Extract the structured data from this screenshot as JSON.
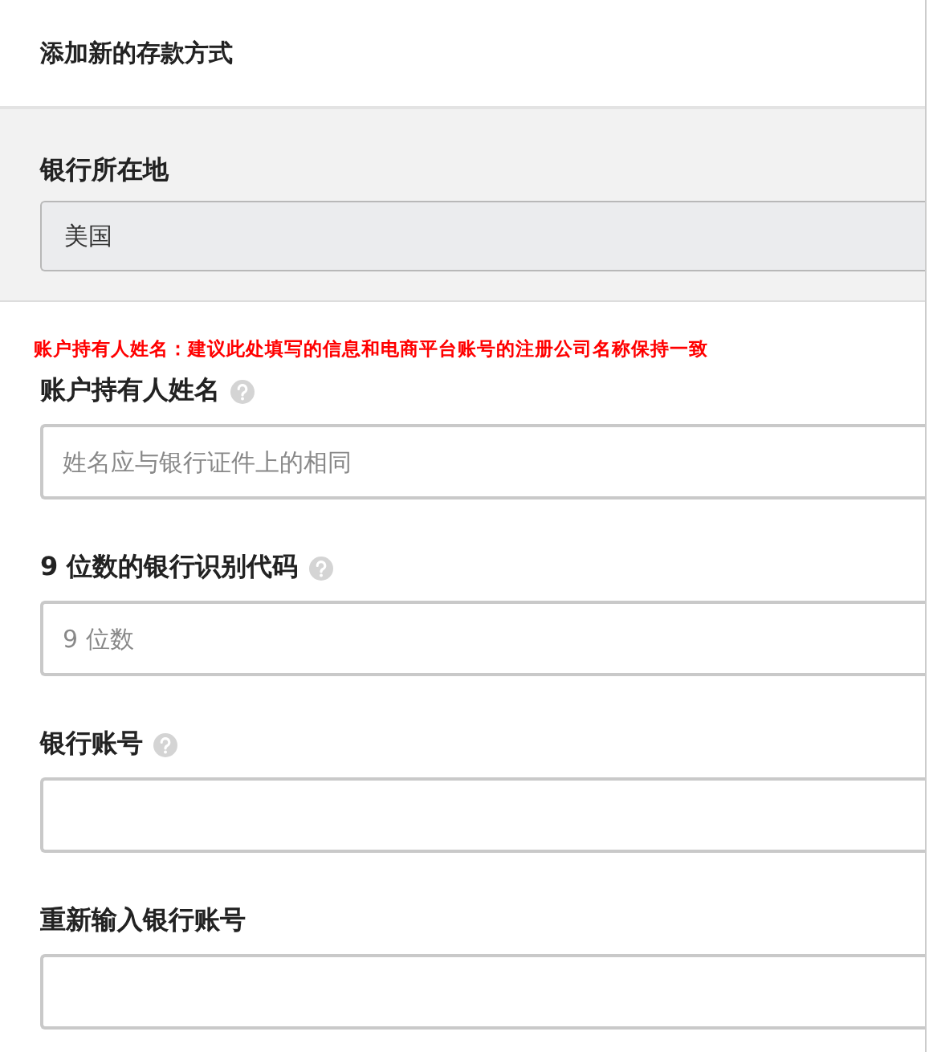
{
  "title": "添加新的存款方式",
  "location": {
    "label": "银行所在地",
    "value": "美国"
  },
  "notice": "账户持有人姓名：建议此处填写的信息和电商平台账号的注册公司名称保持一致",
  "fields": [
    {
      "label": "账户持有人姓名",
      "help": true,
      "placeholder": "姓名应与银行证件上的相同"
    },
    {
      "label": "9 位数的银行识别代码",
      "help": true,
      "placeholder": "9 位数"
    },
    {
      "label": "银行账号",
      "help": true
    },
    {
      "label": "重新输入银行账号",
      "help": false
    }
  ]
}
